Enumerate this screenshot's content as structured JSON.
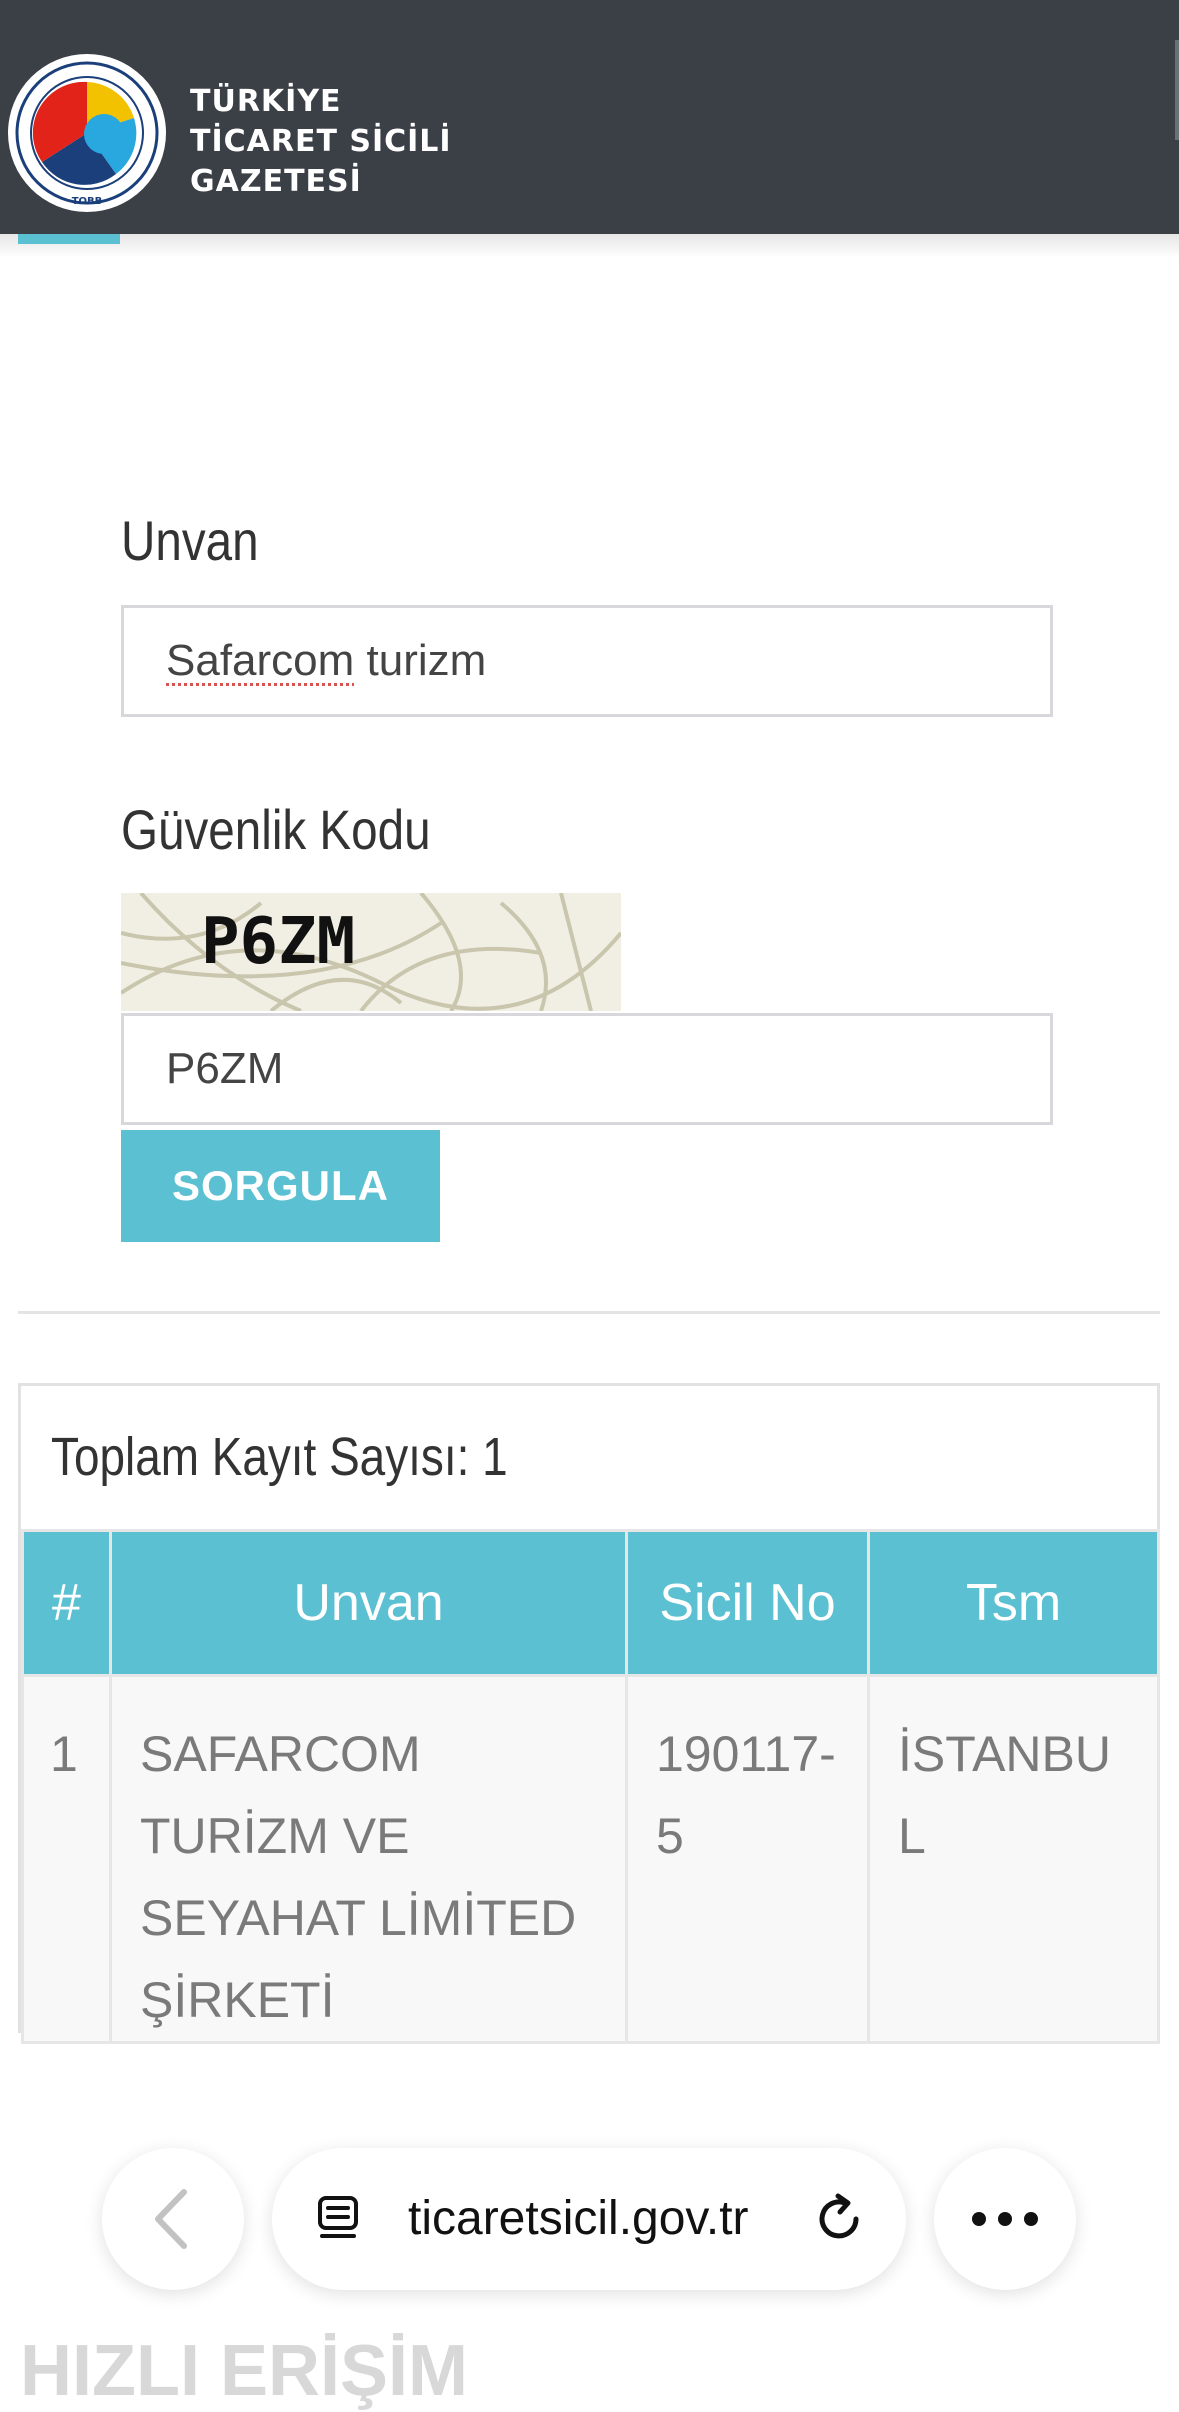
{
  "header": {
    "logo_lines": [
      "TÜRKİYE",
      "TİCARET SİCİLİ",
      "GAZETESİ"
    ],
    "seal_text": "TÜRKİYE ODALAR VE BORSALAR BİRLİĞİ",
    "seal_abbr": "TOBB"
  },
  "form": {
    "unvan_label": "Unvan",
    "unvan_value": "Safarcom turizm",
    "security_label": "Güvenlik Kodu",
    "captcha_text": "P6ZM",
    "captcha_value": "P6ZM",
    "submit_label": "SORGULA"
  },
  "results": {
    "total_label": "Toplam Kayıt Sayısı: 1",
    "columns": [
      "#",
      "Unvan",
      "Sicil No",
      "Tsm"
    ],
    "rows": [
      {
        "num": "1",
        "unvan": "SAFARCOM TURİZM VE SEYAHAT LİMİTED ŞİRKETİ",
        "sicil_no": "190117-5",
        "tsm": "İSTANBUL"
      }
    ]
  },
  "browser": {
    "url": "ticaretsicil.gov.tr",
    "icons": {
      "back": "chevron-left-icon",
      "site": "page-icon",
      "reload": "reload-icon",
      "more": "more-dots-icon"
    }
  },
  "peek_heading": "HIZLI ERİŞİM",
  "colors": {
    "header_bg": "#3b3f46",
    "accent": "#5bc0d2"
  }
}
